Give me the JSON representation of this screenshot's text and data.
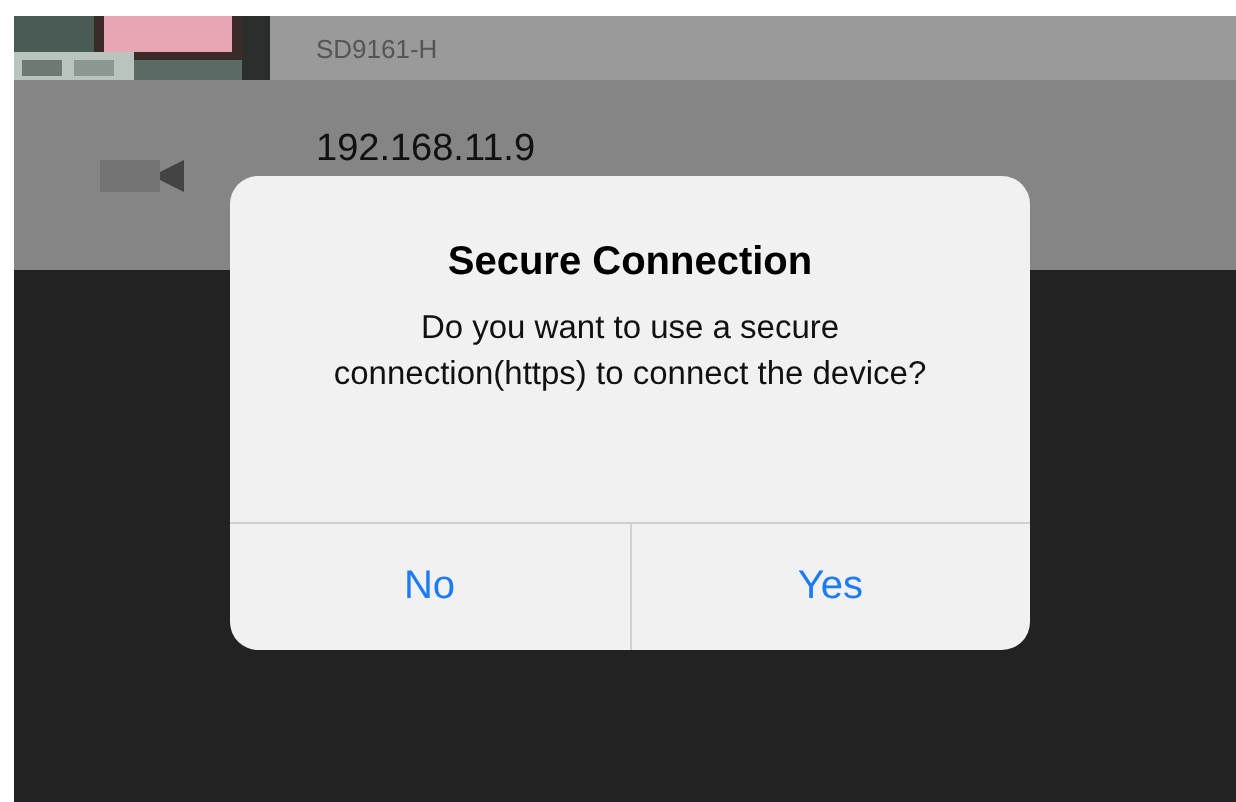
{
  "devices": [
    {
      "name": "SD9161-H",
      "kind": "picture"
    },
    {
      "name": "192.168.11.9",
      "kind": "camera"
    }
  ],
  "dialog": {
    "title": "Secure Connection",
    "message": "Do you want to use a secure connection(https) to connect the device?",
    "buttons": [
      "No",
      "Yes"
    ]
  }
}
